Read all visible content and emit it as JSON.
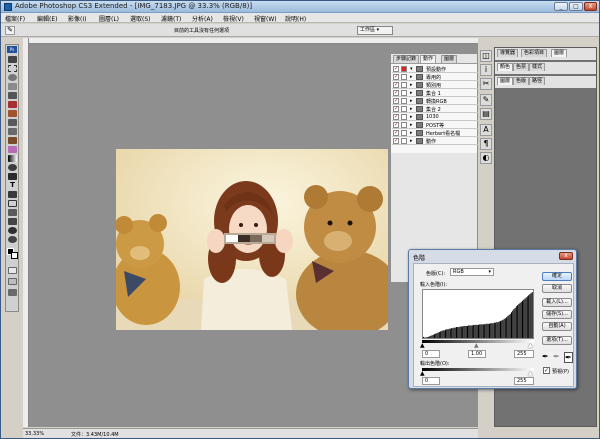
{
  "app": {
    "title": "Adobe Photoshop CS3 Extended - [IMG_7183.JPG @ 33.3% (RGB/8)]",
    "window_buttons": {
      "minimize": "_",
      "maximize": "□",
      "close": "X"
    }
  },
  "menu": [
    "檔案(F)",
    "編輯(E)",
    "影像(I)",
    "圖層(L)",
    "選取(S)",
    "濾鏡(T)",
    "分析(A)",
    "檢視(V)",
    "視窗(W)",
    "說明(H)"
  ],
  "options_bar": {
    "hint": "目前的工具沒有任何選項",
    "workspace": "工作區 ▾"
  },
  "status_bar": {
    "zoom": "33.33%",
    "doc": "文件：3.43M/10.4M"
  },
  "layers_panel": {
    "tabs": [
      "步驟記錄",
      "動作",
      "圖層"
    ],
    "actions": [
      {
        "name": "預設動作",
        "checked": true
      },
      {
        "name": "專用的",
        "checked": true
      },
      {
        "name": "類別用",
        "checked": true
      },
      {
        "name": "集合 1",
        "checked": true
      },
      {
        "name": "轉換RGB",
        "checked": true
      },
      {
        "name": "集合 2",
        "checked": true
      },
      {
        "name": "1030",
        "checked": true
      },
      {
        "name": "POST等",
        "checked": true
      },
      {
        "name": "Herbert看名檔",
        "checked": true
      },
      {
        "name": "動作",
        "checked": true
      }
    ]
  },
  "right_panels": {
    "group1": [
      "導覽器",
      "色彩項目",
      "圖層"
    ],
    "group2": [
      "顏色",
      "色票",
      "樣式"
    ],
    "group3": [
      "圖層",
      "色版",
      "路徑"
    ]
  },
  "levels_dialog": {
    "title": "色階",
    "channel_label": "色版(C):",
    "channel_value": "RGB",
    "input_label": "輸入色階(I):",
    "input_values": [
      "0",
      "1.00",
      "255"
    ],
    "output_label": "輸出色階(O):",
    "output_values": [
      "0",
      "255"
    ],
    "buttons": {
      "ok": "確定",
      "cancel": "取消",
      "load": "載入(L)...",
      "save": "儲存(S)...",
      "auto": "自動(A)",
      "options": "選項(T)..."
    },
    "preview_label": "預視(P)",
    "preview_checked": true
  },
  "histogram": [
    2,
    1,
    1,
    2,
    2,
    3,
    4,
    5,
    6,
    7,
    8,
    9,
    10,
    11,
    12,
    13,
    14,
    14,
    15,
    16,
    16,
    17,
    17,
    18,
    18,
    19,
    19,
    20,
    20,
    20,
    21,
    21,
    21,
    22,
    22,
    22,
    22,
    23,
    23,
    23,
    23,
    24,
    24,
    24,
    24,
    24,
    25,
    25,
    25,
    25,
    25,
    26,
    26,
    26,
    26,
    27,
    27,
    27,
    28,
    28,
    29,
    29,
    30,
    31,
    32,
    33,
    35,
    36,
    38,
    40,
    42,
    44,
    47,
    50,
    53,
    55,
    58,
    60,
    62,
    64,
    66,
    68,
    70,
    72,
    74,
    76,
    78,
    80,
    82,
    84
  ]
}
